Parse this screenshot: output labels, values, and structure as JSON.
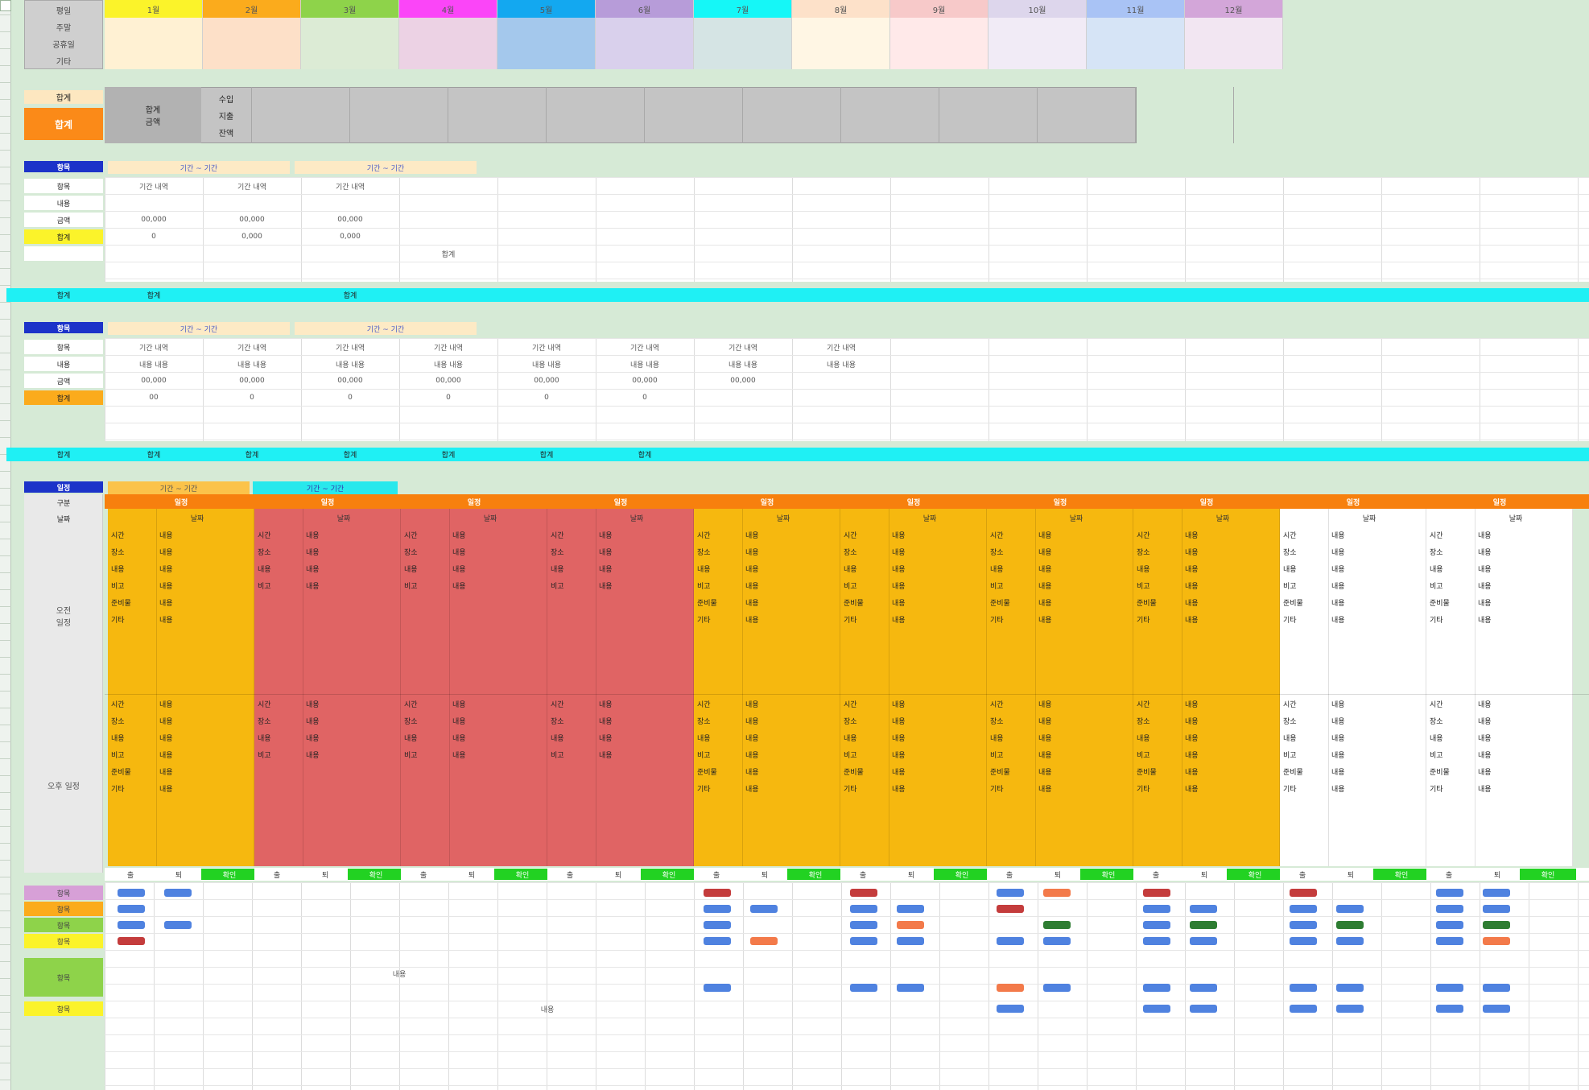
{
  "sheet": {
    "colors": {
      "sheet_bg": "#d6ead6",
      "cyan_bar": "#1ff0f4",
      "blue_tag": "#1c33c9",
      "yellow_tag": "#fbf32a",
      "orange_tag": "#fb8a18",
      "amber_block": "#f6b80f",
      "red_block": "#e06464",
      "orange_header": "#f7800e"
    },
    "top_header": {
      "label_rows": [
        "평일",
        "주말",
        "공휴일",
        "기타"
      ],
      "columns": [
        {
          "label": "1월",
          "color": "#fbf32a",
          "sub": "#fff1d3"
        },
        {
          "label": "2월",
          "color": "#fbab1c",
          "sub": "#fde0c8"
        },
        {
          "label": "3월",
          "color": "#8ed34a",
          "sub": "#dcebd5"
        },
        {
          "label": "4월",
          "color": "#fb45f8",
          "sub": "#ecd2e4"
        },
        {
          "label": "5월",
          "color": "#13a8f0",
          "sub": "#a4c8ec"
        },
        {
          "label": "6월",
          "color": "#b79cd9",
          "sub": "#d9d0ec"
        },
        {
          "label": "7월",
          "color": "#15f7f7",
          "sub": "#d5e4e4"
        },
        {
          "label": "8월",
          "color": "#fde1c9",
          "sub": "#fff6e4"
        },
        {
          "label": "9월",
          "color": "#f7c9c9",
          "sub": "#ffe9e9"
        },
        {
          "label": "10월",
          "color": "#ddd6ec",
          "sub": "#f1ebf6"
        },
        {
          "label": "11월",
          "color": "#a9c3f5",
          "sub": "#d6e4f6"
        },
        {
          "label": "12월",
          "color": "#d3a6d9",
          "sub": "#f2e6f2"
        }
      ]
    },
    "grey_block": {
      "tag_top": "합계",
      "tag_main": "합계",
      "col1": "합계\n금액",
      "rows": [
        "수입",
        "지출",
        "잔액"
      ]
    },
    "section1": {
      "tag": "항목",
      "headers": [
        "기간 ~ 기간",
        "기간 ~ 기간"
      ],
      "rows": [
        {
          "label": "항목",
          "cells": [
            "기간 내역",
            "기간 내역",
            "기간 내역"
          ]
        },
        {
          "label": "내용",
          "cells": [
            "",
            "",
            ""
          ]
        },
        {
          "label": "금액",
          "cells": [
            "00,000",
            "00,000",
            "00,000"
          ]
        },
        {
          "label": "합계",
          "cells": [
            "0",
            "0,000",
            "0,000"
          ]
        },
        {
          "label": "",
          "cells": [
            "",
            "",
            "",
            "합계"
          ]
        }
      ],
      "summary_label": "합계",
      "summary_cells": [
        "합계",
        "",
        "합계"
      ]
    },
    "section2": {
      "tag": "항목",
      "headers": [
        "기간 ~ 기간",
        "기간 ~ 기간"
      ],
      "rows": [
        {
          "label": "항목",
          "cells": [
            "기간 내역",
            "기간 내역",
            "기간 내역",
            "기간 내역",
            "기간 내역",
            "기간 내역",
            "기간 내역",
            "기간 내역"
          ]
        },
        {
          "label": "내용",
          "cells": [
            "내용 내용",
            "내용 내용",
            "내용 내용",
            "내용 내용",
            "내용 내용",
            "내용 내용",
            "내용 내용",
            "내용 내용"
          ]
        },
        {
          "label": "금액",
          "cells": [
            "00,000",
            "00,000",
            "00,000",
            "00,000",
            "00,000",
            "00,000",
            "00,000",
            ""
          ]
        },
        {
          "label": "합계",
          "cells": [
            "00",
            "0",
            "0",
            "0",
            "0",
            "0",
            "",
            ""
          ]
        }
      ],
      "summary_label": "합계",
      "summary_cells": [
        "합계",
        "합계",
        "합계",
        "합계",
        "합계",
        "합계"
      ]
    },
    "section3": {
      "tag": "일정",
      "tag_a": "기간 ~ 기간",
      "tag_b": "기간 ~ 기간",
      "row_labels": [
        "구분",
        "날짜",
        "오전\n일정",
        "오후 일정"
      ],
      "day_headers": [
        "일정",
        "일정",
        "일정",
        "일정",
        "일정",
        "일정",
        "일정",
        "일정",
        "일정",
        "일정"
      ],
      "day_subs": [
        "날짜",
        "날짜",
        "날짜",
        "날짜",
        "날짜",
        "날짜",
        "날짜",
        "날짜",
        "날짜",
        "날짜"
      ],
      "block_keys": [
        "시간",
        "장소",
        "내용",
        "비고",
        "준비물",
        "기타"
      ],
      "block_value": "내용",
      "status_heads": [
        "출",
        "퇴",
        "확인"
      ],
      "bottom_labels": [
        "항목",
        "항목",
        "항목",
        "항목",
        "항목",
        "항목"
      ],
      "bottom_note": "내용"
    }
  }
}
